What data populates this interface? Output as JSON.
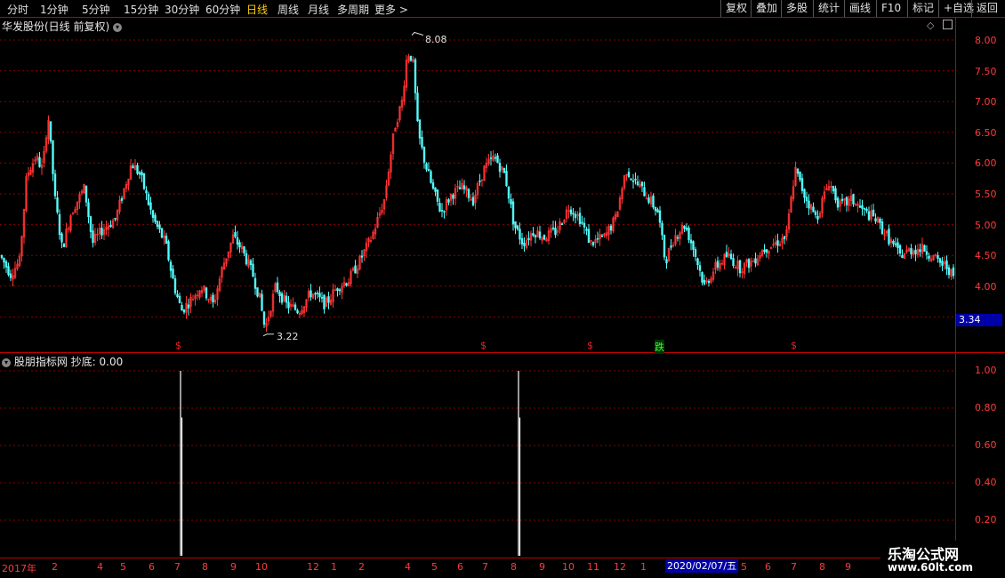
{
  "toolbar": {
    "periods": [
      "分时",
      "1分钟",
      "5分钟",
      "15分钟",
      "30分钟",
      "60分钟",
      "日线",
      "周线",
      "月线",
      "多周期",
      "更多"
    ],
    "active_period": "日线",
    "buttons": [
      "复权",
      "叠加",
      "多股",
      "统计",
      "画线",
      "F10",
      "标记",
      "+自选",
      "返回"
    ]
  },
  "main_chart": {
    "title": "华发股份(日线 前复权)",
    "y_ticks": [
      "8.00",
      "7.50",
      "7.00",
      "6.50",
      "6.00",
      "5.50",
      "5.00",
      "4.50",
      "4.00"
    ],
    "high_label": "8.08",
    "low_label": "3.22",
    "current_price": "3.34",
    "signals": [
      {
        "text": "$",
        "color": "red"
      },
      {
        "text": "$",
        "color": "red"
      },
      {
        "text": "$",
        "color": "red"
      },
      {
        "text": "跌",
        "color": "green"
      },
      {
        "text": "$",
        "color": "red"
      }
    ]
  },
  "indicator": {
    "title": "股朋指标网 抄底: 0.00",
    "y_ticks": [
      "1.00",
      "0.80",
      "0.60",
      "0.40",
      "0.20"
    ]
  },
  "x_axis": {
    "labels": [
      "2017年",
      "2",
      "4",
      "5",
      "6",
      "7",
      "8",
      "9",
      "10",
      "12",
      "1",
      "2",
      "4",
      "5",
      "6",
      "7",
      "8",
      "9",
      "10",
      "11",
      "12",
      "1",
      "5",
      "6",
      "7",
      "8",
      "9"
    ],
    "cursor_date": "2020/02/07/五"
  },
  "watermark": {
    "line1": "乐淘公式网",
    "line2": "www.60lt.com"
  },
  "colors": {
    "up": "#ff3333",
    "down": "#54ffff",
    "axis": "#c00000",
    "grid": "#8a0000",
    "signal_bar": "#ffffff"
  },
  "chart_data": [
    {
      "type": "candlestick",
      "title": "华发股份(日线 前复权)",
      "ylim": [
        3.2,
        8.1
      ],
      "x": [
        "2017-01",
        "2017-02",
        "2017-04",
        "2017-05",
        "2017-06",
        "2017-07",
        "2017-08",
        "2017-09",
        "2017-10",
        "2017-12",
        "2018-01",
        "2018-02",
        "2018-04",
        "2018-05",
        "2018-06",
        "2018-07",
        "2018-08",
        "2018-09",
        "2018-10",
        "2018-11",
        "2018-12",
        "2019-01",
        "2019-02",
        "2019-05",
        "2019-06",
        "2019-07",
        "2019-08",
        "2019-09"
      ],
      "close_approx": [
        4.4,
        6.8,
        5.2,
        4.8,
        5.8,
        3.9,
        4.0,
        4.8,
        3.5,
        3.7,
        4.0,
        6.2,
        7.6,
        6.2,
        5.2,
        5.6,
        6.1,
        4.8,
        5.3,
        4.9,
        5.3,
        5.8,
        5.2,
        4.4,
        4.6,
        5.9,
        5.3,
        4.3
      ],
      "high_label": 8.08,
      "low_label": 3.22,
      "current": 3.34
    },
    {
      "type": "bar",
      "title": "股朋指标网 抄底: 0.00",
      "ylim": [
        0,
        1.05
      ],
      "spikes": [
        {
          "position": "2017-07",
          "value": 1.0
        },
        {
          "position": "2018-08",
          "value": 1.0
        }
      ]
    }
  ]
}
